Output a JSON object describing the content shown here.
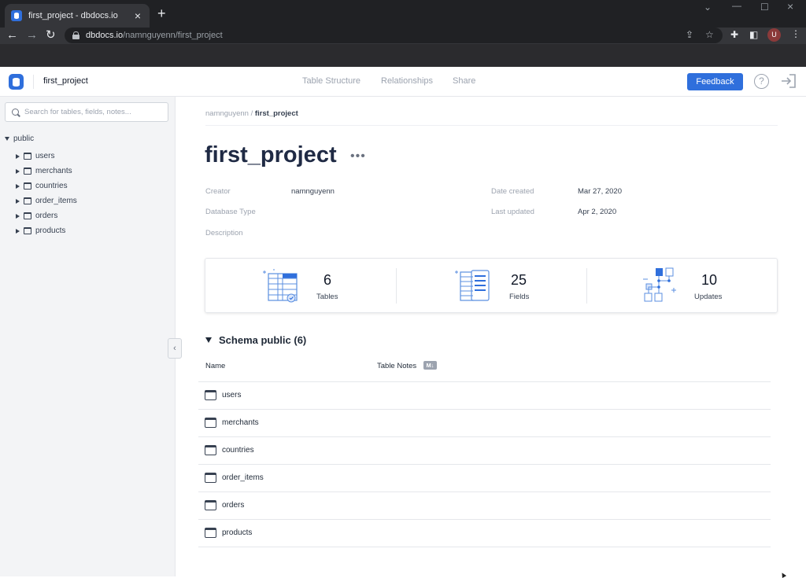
{
  "browser": {
    "tab_title": "first_project - dbdocs.io",
    "url_host": "dbdocs.io",
    "url_path": "/namnguyenn/first_project",
    "profile_initial": "U"
  },
  "header": {
    "project_name": "first_project",
    "nav": [
      "Table Structure",
      "Relationships",
      "Share"
    ],
    "feedback_label": "Feedback",
    "help_glyph": "?"
  },
  "sidebar": {
    "search_placeholder": "Search for tables, fields, notes...",
    "root": "public",
    "items": [
      "users",
      "merchants",
      "countries",
      "order_items",
      "orders",
      "products"
    ]
  },
  "breadcrumb": {
    "owner": "namnguyenn",
    "separator": " / ",
    "project": "first_project"
  },
  "project": {
    "title": "first_project",
    "more": "•••",
    "creator_label": "Creator",
    "creator_value": "namnguyenn",
    "db_type_label": "Database Type",
    "description_label": "Description",
    "date_created_label": "Date created",
    "date_created_value": "Mar 27, 2020",
    "last_updated_label": "Last updated",
    "last_updated_value": "Apr 2, 2020"
  },
  "stats": [
    {
      "value": "6",
      "label": "Tables"
    },
    {
      "value": "25",
      "label": "Fields"
    },
    {
      "value": "10",
      "label": "Updates"
    }
  ],
  "schema": {
    "heading": "Schema public (6)",
    "col_name": "Name",
    "col_notes": "Table Notes",
    "md_badge": "M↓",
    "tables": [
      "users",
      "merchants",
      "countries",
      "order_items",
      "orders",
      "products"
    ]
  },
  "colors": {
    "accent": "#2f6fdc",
    "chrome_dark": "#202124",
    "sidebar_bg": "#f3f4f6"
  }
}
